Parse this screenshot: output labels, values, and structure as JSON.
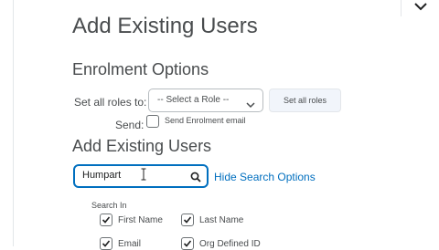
{
  "page": {
    "title": "Add Existing Users"
  },
  "enrolment": {
    "heading": "Enrolment Options",
    "set_all_roles_label": "Set all roles to:",
    "role_select_value": "-- Select a Role --",
    "set_all_roles_button": "Set all roles",
    "send_label": "Send:",
    "send_email_label": "Send Enrolment email",
    "send_email_checked": false
  },
  "search": {
    "heading": "Add Existing Users",
    "value": "Humpart",
    "hide_options_link": "Hide Search Options",
    "search_in_label": "Search In",
    "fields": [
      {
        "label": "First Name",
        "checked": true
      },
      {
        "label": "Last Name",
        "checked": true
      },
      {
        "label": "Email",
        "checked": true
      },
      {
        "label": "Org Defined ID",
        "checked": true
      }
    ]
  },
  "colors": {
    "link": "#006fbf",
    "focus_border": "#006fbf",
    "text": "#494c4e"
  }
}
